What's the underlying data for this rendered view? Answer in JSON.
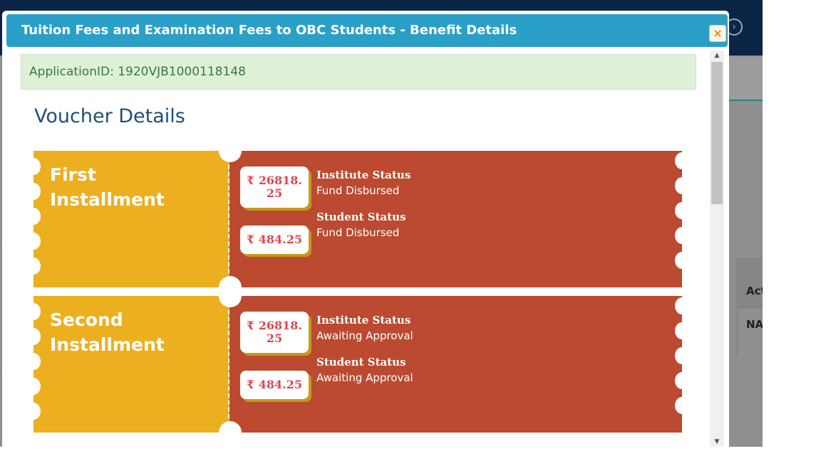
{
  "modal": {
    "title": "Tuition Fees and Examination Fees to OBC Students - Benefit Details",
    "close_label": "×",
    "application_id": "ApplicationID: 1920VJB1000118148",
    "section_title": "Voucher Details"
  },
  "vouchers": [
    {
      "title_line1": "First",
      "title_line2": "Installment",
      "institute_amount": "₹ 26818.25",
      "student_amount": "₹ 484.25",
      "institute_status_label": "Institute Status",
      "institute_status": "Fund Disbursed",
      "student_status_label": "Student Status",
      "student_status": "Fund Disbursed"
    },
    {
      "title_line1": "Second",
      "title_line2": "Installment",
      "institute_amount": "₹ 26818.25",
      "student_amount": "₹ 484.25",
      "institute_status_label": "Institute Status",
      "institute_status": "Awaiting Approval",
      "student_status_label": "Student Status",
      "student_status": "Awaiting Approval"
    }
  ],
  "background": {
    "table_header": "Act",
    "table_cell": "NA"
  },
  "icons": {
    "close": "close-icon",
    "header_nav": "chevron-right-circle-icon"
  },
  "colors": {
    "header": "#2aa0c8",
    "voucher_left": "#ecaf1f",
    "voucher_right": "#bb4a30",
    "amount_text": "#e0464a",
    "id_box": "#dff0d8"
  }
}
